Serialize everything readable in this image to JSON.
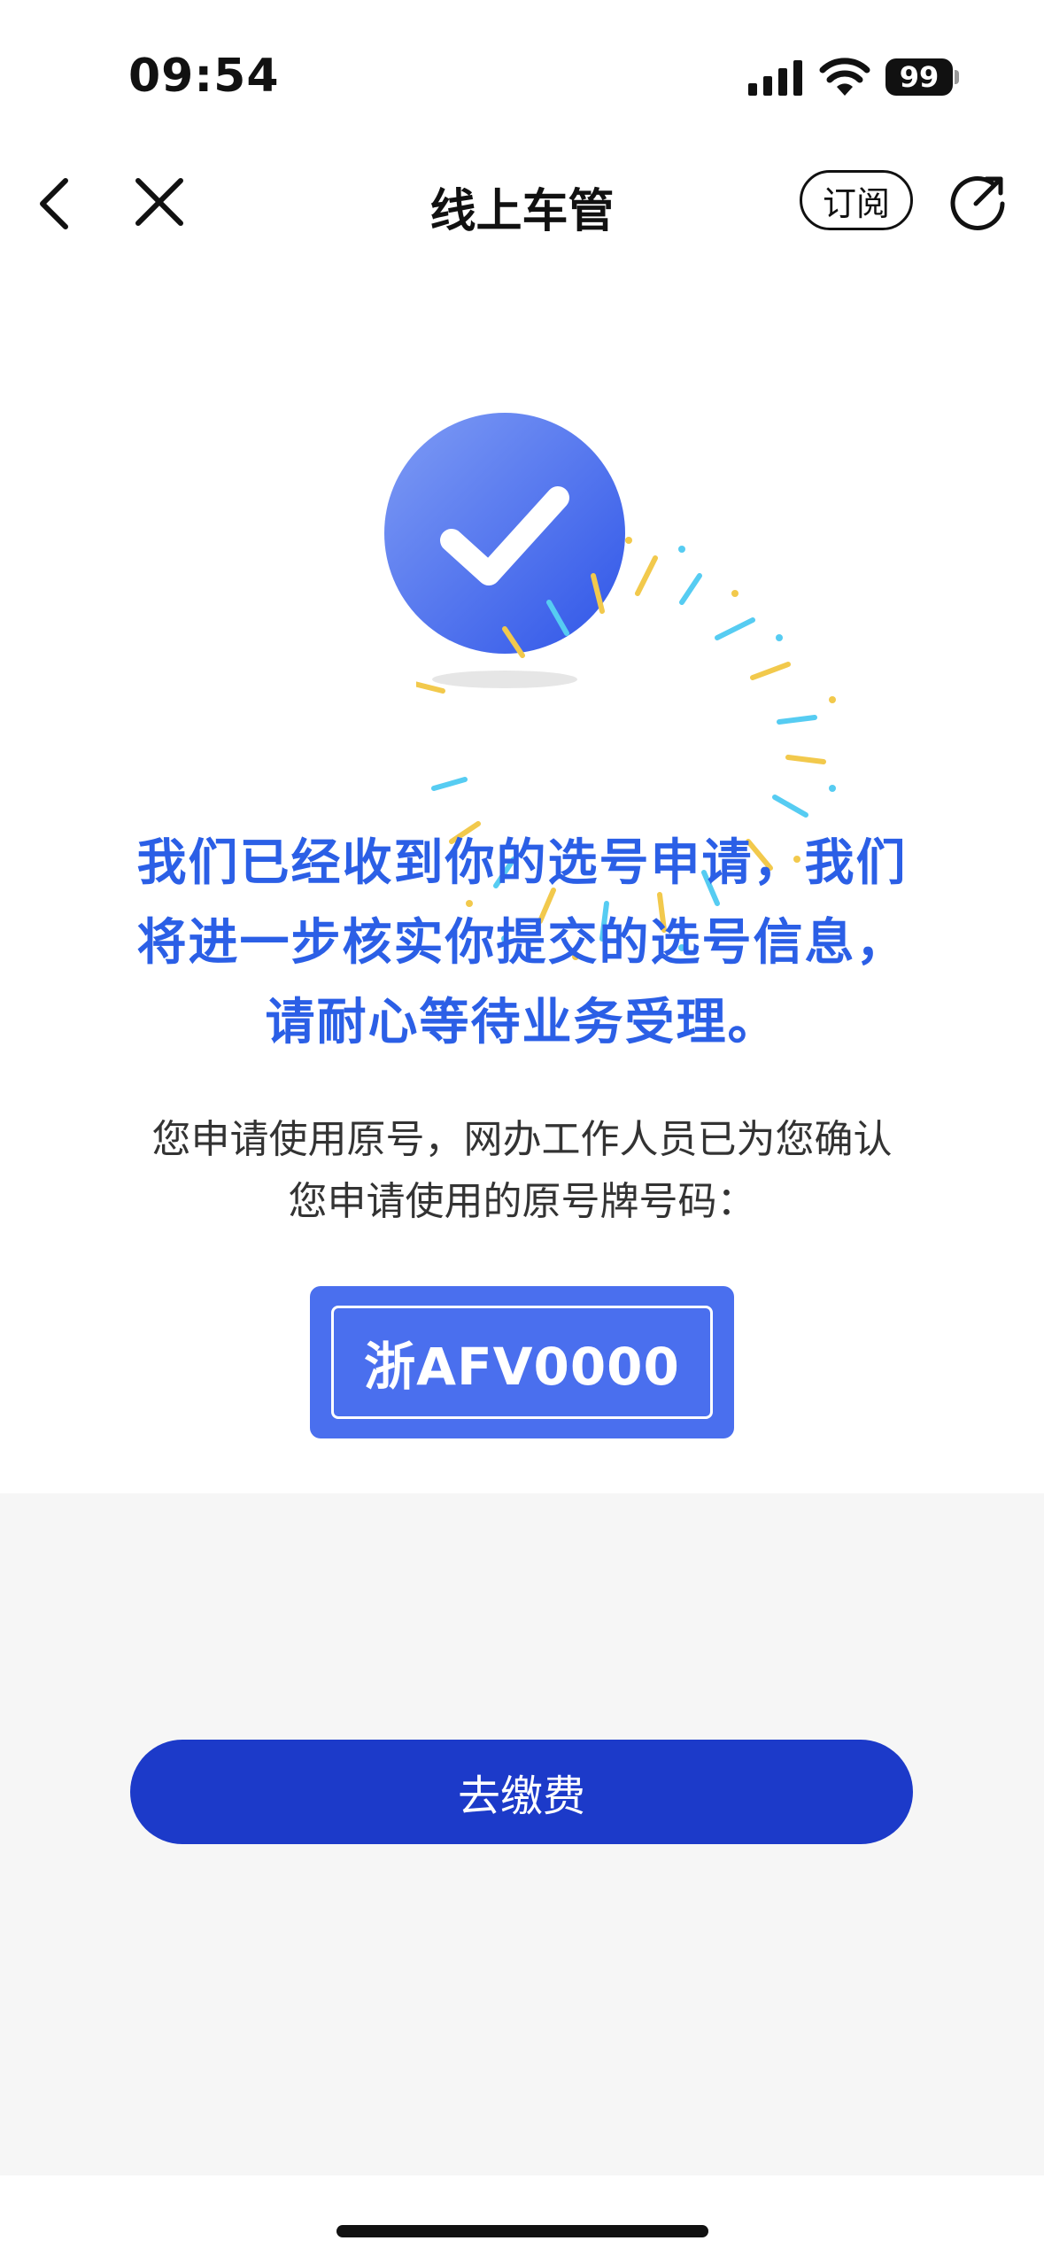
{
  "status_bar": {
    "time": "09:54",
    "battery": "99"
  },
  "nav": {
    "title": "线上车管",
    "subscribe_label": "订阅"
  },
  "message": {
    "main_lines": [
      "我们已经收到你的选号申请，我们",
      "将进一步核实你提交的选号信息，",
      "请耐心等待业务受理。"
    ],
    "description_lines": [
      "您申请使用原号，网办工作人员已为您确认",
      "您申请使用的原号牌号码："
    ]
  },
  "plate": {
    "number": "浙AFV0000"
  },
  "actions": {
    "pay_label": "去缴费"
  },
  "colors": {
    "accent": "#2b5fe6",
    "plate_bg": "#4a6fee",
    "button_bg": "#1c3ac9",
    "panel_bg": "#f6f6f6"
  }
}
